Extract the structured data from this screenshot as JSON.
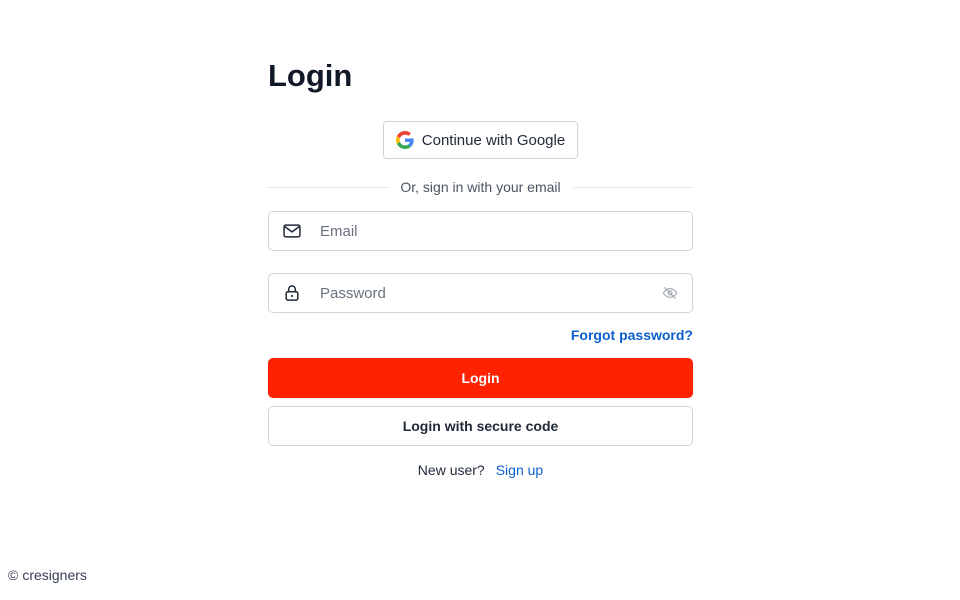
{
  "login": {
    "title": "Login",
    "google_button_label": "Continue with Google",
    "divider_text": "Or, sign in with your email",
    "email_placeholder": "Email",
    "password_placeholder": "Password",
    "forgot_password_label": "Forgot password?",
    "login_button_label": "Login",
    "secure_code_button_label": "Login with secure code",
    "new_user_text": "New user?",
    "sign_up_label": "Sign up"
  },
  "footer": {
    "copyright_symbol": "©",
    "brand": "cresigners"
  },
  "icons": {
    "google": "google-logo-icon",
    "email": "mail-icon",
    "password": "lock-icon",
    "toggle_visibility": "eye-off-icon"
  },
  "colors": {
    "primary": "#ff2200",
    "link": "#0b5fcc",
    "border": "#d1d5db"
  }
}
